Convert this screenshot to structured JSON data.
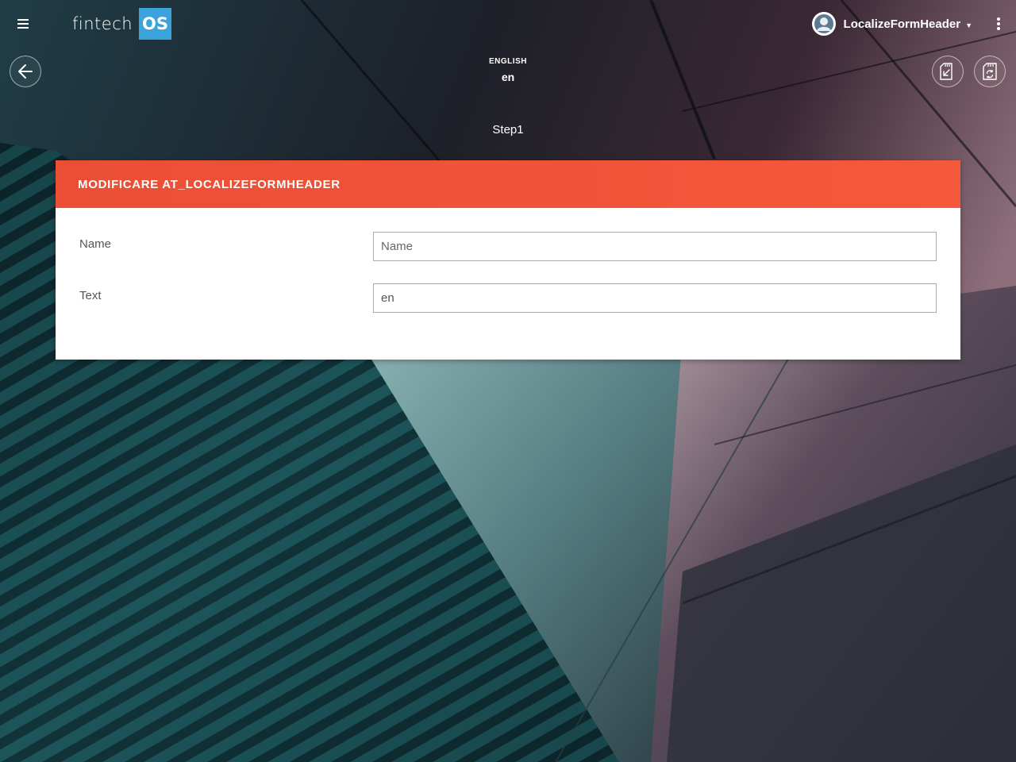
{
  "header": {
    "brand_text": "fintech",
    "brand_box": "OS",
    "user_name": "LocalizeFormHeader"
  },
  "language": {
    "label": "ENGLISH",
    "code": "en"
  },
  "step": {
    "label": "Step1"
  },
  "form": {
    "title": "MODIFICARE AT_LOCALIZEFORMHEADER",
    "fields": [
      {
        "label": "Name",
        "value": "",
        "placeholder": "Name"
      },
      {
        "label": "Text",
        "value": "en",
        "placeholder": ""
      }
    ]
  },
  "icons": {
    "menu": "hamburger-icon",
    "back": "arrow-left-icon",
    "user": "avatar-icon",
    "more": "kebab-icon",
    "action1": "sd-card-import-icon",
    "action2": "sd-card-refresh-icon"
  },
  "colors": {
    "accent": "#f05536",
    "brand": "#3aa3dc"
  }
}
